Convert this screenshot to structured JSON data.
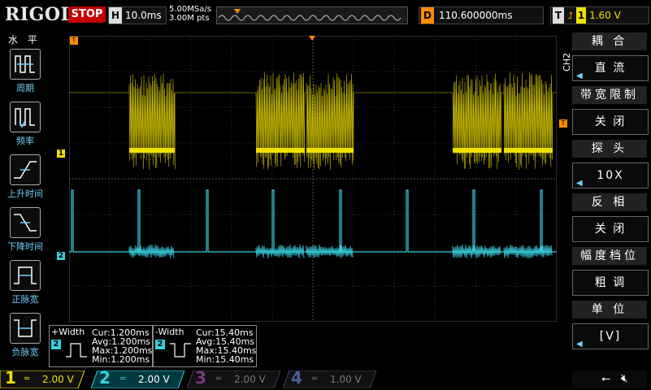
{
  "header": {
    "brand": "RIGOL",
    "run_state": "STOP",
    "timebase_label": "H",
    "timebase_value": "10.0ms",
    "sample_rate": "5.00MSa/s",
    "memory_depth": "3.00M pts",
    "delay_label": "D",
    "delay_value": "110.600000ms",
    "trigger_label": "T",
    "trigger_source": "1",
    "trigger_level": "1.60 V"
  },
  "left_menu": {
    "title": "水 平",
    "items": [
      {
        "label": "周期",
        "icon": "period-icon"
      },
      {
        "label": "频率",
        "icon": "frequency-icon"
      },
      {
        "label": "上升时间",
        "icon": "rise-time-icon"
      },
      {
        "label": "下降时间",
        "icon": "fall-time-icon"
      },
      {
        "label": "正脉宽",
        "icon": "positive-width-icon"
      },
      {
        "label": "负脉宽",
        "icon": "negative-width-icon"
      }
    ]
  },
  "right_menu": {
    "channel_tag": "CH2",
    "sections": [
      {
        "head": "耦 合",
        "value": "直 流"
      },
      {
        "head": "带宽限制",
        "value": "关 闭"
      },
      {
        "head": "探 头",
        "value": "10X"
      },
      {
        "head": "反 相",
        "value": "关 闭"
      },
      {
        "head": "幅度档位",
        "value": "粗 调"
      },
      {
        "head": "单 位",
        "value": "[V]"
      }
    ]
  },
  "measurements": [
    {
      "title": "+Width",
      "channel": "2",
      "cur": "Cur:1.200ms",
      "avg": "Avg:1.200ms",
      "max": "Max:1.200ms",
      "min": "Min:1.200ms"
    },
    {
      "title": "-Width",
      "channel": "2",
      "cur": "Cur:15.40ms",
      "avg": "Avg:15.40ms",
      "max": "Max:15.40ms",
      "min": "Min:15.40ms"
    }
  ],
  "channels": [
    {
      "num": "1",
      "scale": "2.00 V",
      "color": "#f0e000"
    },
    {
      "num": "2",
      "scale": "2.00 V",
      "color": "#39d0e0"
    },
    {
      "num": "3",
      "scale": "2.00 V",
      "color": "#c040c0"
    },
    {
      "num": "4",
      "scale": "1.00 V",
      "color": "#4070ff"
    }
  ],
  "markers": {
    "ch1": "1",
    "ch2": "2",
    "trigger": "T"
  },
  "colors": {
    "ch1": "#f0e000",
    "ch2": "#39d0e0",
    "trigger": "#ff8c00",
    "accent": "#6fd0ff"
  }
}
